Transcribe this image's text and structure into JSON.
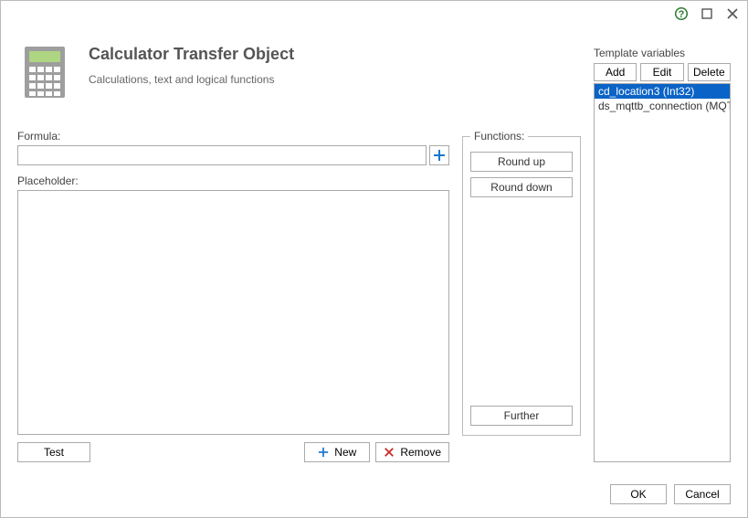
{
  "titlebar": {
    "help_icon": "help-icon",
    "max_icon": "maximize-icon",
    "close_icon": "close-icon"
  },
  "header": {
    "title": "Calculator Transfer Object",
    "subtitle": "Calculations, text and logical functions"
  },
  "form": {
    "formula_label": "Formula:",
    "formula_value": "",
    "placeholder_label": "Placeholder:",
    "placeholder_value": "",
    "test_label": "Test",
    "new_label": "New",
    "remove_label": "Remove"
  },
  "functions": {
    "legend": "Functions:",
    "round_up": "Round up",
    "round_down": "Round down",
    "further": "Further"
  },
  "template_variables": {
    "label": "Template variables",
    "add": "Add",
    "edit": "Edit",
    "delete": "Delete",
    "items": [
      {
        "label": "cd_location3 (Int32)",
        "selected": true
      },
      {
        "label": "ds_mqttb_connection (MQTT)",
        "selected": false
      }
    ]
  },
  "footer": {
    "ok": "OK",
    "cancel": "Cancel"
  }
}
